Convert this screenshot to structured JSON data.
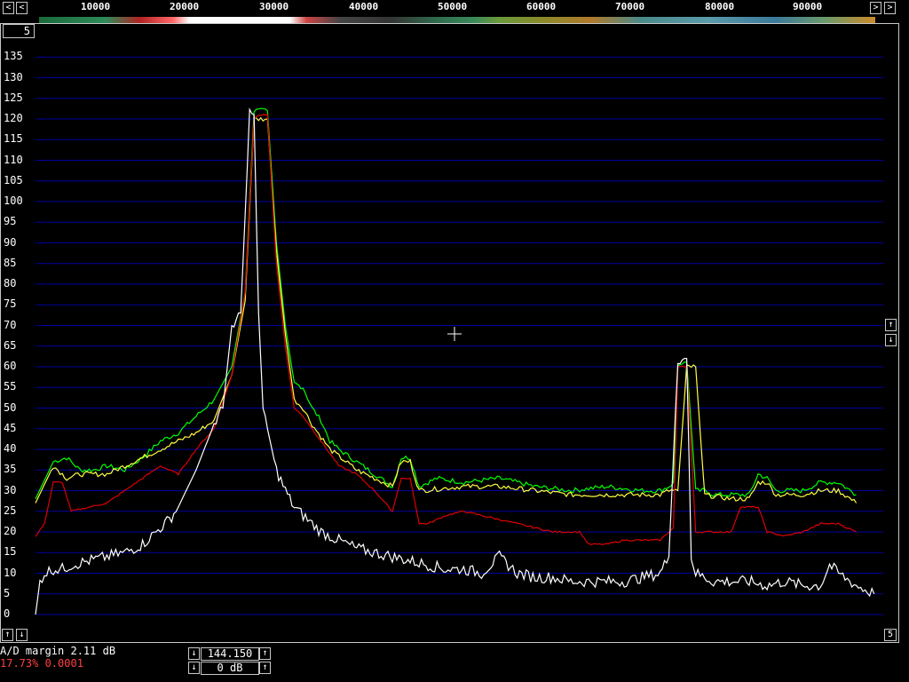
{
  "freq_scale": {
    "labels": [
      "10000",
      "20000",
      "30000",
      "40000",
      "50000",
      "60000",
      "70000",
      "80000",
      "90000"
    ],
    "left_arrow": "<",
    "right_arrow": ">"
  },
  "corner_label": "5",
  "y_axis": {
    "labels": [
      "135",
      "130",
      "125",
      "120",
      "115",
      "110",
      "105",
      "100",
      "95",
      "90",
      "85",
      "80",
      "75",
      "70",
      "65",
      "60",
      "55",
      "50",
      "45",
      "40",
      "35",
      "30",
      "25",
      "20",
      "15",
      "10",
      "5",
      "0"
    ]
  },
  "side_buttons": {
    "up": "↑",
    "down": "↓"
  },
  "bottom_left_buttons": {
    "up": "↑",
    "down": "↓"
  },
  "bottom_right_label": "5",
  "status": {
    "ad_margin": "A/D margin  2.11 dB",
    "load": "17.73% 0.0001"
  },
  "freq_box": {
    "value": "144.150",
    "gain": "0 dB",
    "up": "↑",
    "down": "↓"
  },
  "colors": {
    "grid": "#0000a0",
    "green": "#00ff00",
    "yellow": "#ffff40",
    "red": "#dd0000",
    "white": "#ffffff",
    "status_red": "#ff4040"
  },
  "chart_data": {
    "type": "line",
    "x_label_ticks": [
      10000,
      20000,
      30000,
      40000,
      50000,
      60000,
      70000,
      80000,
      90000
    ],
    "ylim": [
      0,
      135
    ],
    "series": [
      {
        "color": "green",
        "x": [
          0,
          2000,
          3500,
          5000,
          6500,
          8000,
          10000,
          12000,
          14000,
          16000,
          18000,
          20000,
          22000,
          23500,
          24500,
          25000,
          26000,
          27000,
          28000,
          29000,
          30000,
          31000,
          32000,
          33000,
          34000,
          36000,
          38000,
          40000,
          41000,
          42000,
          43000,
          45000,
          48000,
          52000,
          56000,
          60000,
          64000,
          68000,
          70000,
          71000,
          71500,
          72000,
          72500,
          73000,
          74000,
          75000,
          76000,
          78000,
          80000,
          81000,
          82000,
          83000,
          84000,
          86000,
          88000,
          90000,
          92000
        ],
        "y": [
          28,
          37,
          38,
          35,
          35,
          36,
          35,
          38,
          42,
          44,
          48,
          52,
          60,
          78,
          122,
          122,
          122,
          90,
          70,
          56,
          55,
          50,
          47,
          42,
          40,
          37,
          34,
          31,
          38,
          38,
          31,
          33,
          32,
          33,
          31,
          30,
          31,
          30,
          30,
          31,
          32,
          60,
          61,
          61,
          30,
          30,
          29,
          29,
          29,
          34,
          33,
          30,
          30,
          30,
          32,
          32,
          29
        ]
      },
      {
        "color": "yellow",
        "x": [
          0,
          2000,
          3500,
          5000,
          8000,
          10000,
          12000,
          14000,
          16000,
          18000,
          20000,
          22000,
          23500,
          24500,
          25000,
          26000,
          27000,
          28000,
          29000,
          30000,
          31000,
          32000,
          33000,
          36000,
          40000,
          41000,
          42000,
          43000,
          48000,
          52000,
          56000,
          60000,
          64000,
          70000,
          71000,
          72000,
          73000,
          74000,
          75000,
          78000,
          80000,
          81000,
          82000,
          83000,
          86000,
          88000,
          90000,
          92000
        ],
        "y": [
          27,
          36,
          33,
          34,
          34,
          36,
          38,
          40,
          42,
          44,
          47,
          58,
          76,
          120,
          120,
          120,
          88,
          68,
          52,
          50,
          46,
          43,
          40,
          35,
          31,
          37,
          37,
          30,
          31,
          31,
          30,
          29,
          29,
          29,
          30,
          30,
          60,
          60,
          29,
          28,
          28,
          32,
          32,
          29,
          29,
          30,
          30,
          27
        ]
      },
      {
        "color": "red",
        "x": [
          0,
          1000,
          2000,
          3000,
          4000,
          6000,
          8000,
          10000,
          12000,
          14000,
          16000,
          18000,
          20000,
          22000,
          23500,
          24500,
          25000,
          26000,
          27000,
          28000,
          29000,
          30000,
          32000,
          34000,
          36000,
          38000,
          40000,
          41000,
          42000,
          43000,
          44000,
          46000,
          48000,
          50000,
          52000,
          54000,
          58000,
          61000,
          62000,
          64000,
          66000,
          68000,
          70000,
          71000,
          71500,
          72000,
          72500,
          73000,
          74000,
          75000,
          76000,
          78000,
          79000,
          80000,
          81000,
          82000,
          84000,
          86000,
          88000,
          90000,
          92000
        ],
        "y": [
          19,
          22,
          32,
          32,
          25,
          26,
          27,
          30,
          33,
          36,
          34,
          40,
          45,
          58,
          78,
          120,
          121,
          121,
          85,
          65,
          50,
          48,
          42,
          36,
          34,
          30,
          25,
          33,
          33,
          22,
          22,
          24,
          25,
          24,
          23,
          22,
          20,
          20,
          17,
          17,
          18,
          18,
          18,
          20,
          21,
          60,
          60,
          60,
          20,
          20,
          20,
          20,
          26,
          26,
          26,
          20,
          19,
          20,
          22,
          22,
          20
        ]
      },
      {
        "color": "white",
        "x": [
          0,
          500,
          1000,
          2000,
          3000,
          4000,
          6000,
          8000,
          10000,
          12000,
          13000,
          14000,
          15000,
          16000,
          18000,
          20000,
          21000,
          22000,
          23000,
          24000,
          24500,
          25000,
          25500,
          26000,
          27000,
          28000,
          29000,
          30000,
          31000,
          32000,
          33000,
          34000,
          36000,
          38000,
          40000,
          42000,
          44000,
          46000,
          48000,
          50000,
          52000,
          54000,
          56000,
          58000,
          60000,
          62000,
          64000,
          66000,
          68000,
          70000,
          71000,
          72000,
          73000,
          73500,
          74000,
          75000,
          76000,
          78000,
          80000,
          82000,
          84000,
          86000,
          88000,
          89000,
          90000,
          92000,
          93000,
          94000
        ],
        "y": [
          0,
          8,
          10,
          11,
          11,
          12,
          13,
          14,
          15,
          17,
          19,
          21,
          23,
          26,
          35,
          46,
          50,
          70,
          73,
          121,
          121,
          73,
          50,
          45,
          35,
          30,
          26,
          24,
          22,
          20,
          19,
          18,
          16,
          15,
          14,
          13,
          12,
          11,
          11,
          10,
          14,
          10,
          9,
          9,
          8,
          8,
          8,
          8,
          9,
          10,
          14,
          62,
          62,
          14,
          10,
          9,
          8,
          8,
          8,
          7,
          8,
          7,
          7,
          12,
          10,
          7,
          6,
          5
        ]
      }
    ]
  }
}
